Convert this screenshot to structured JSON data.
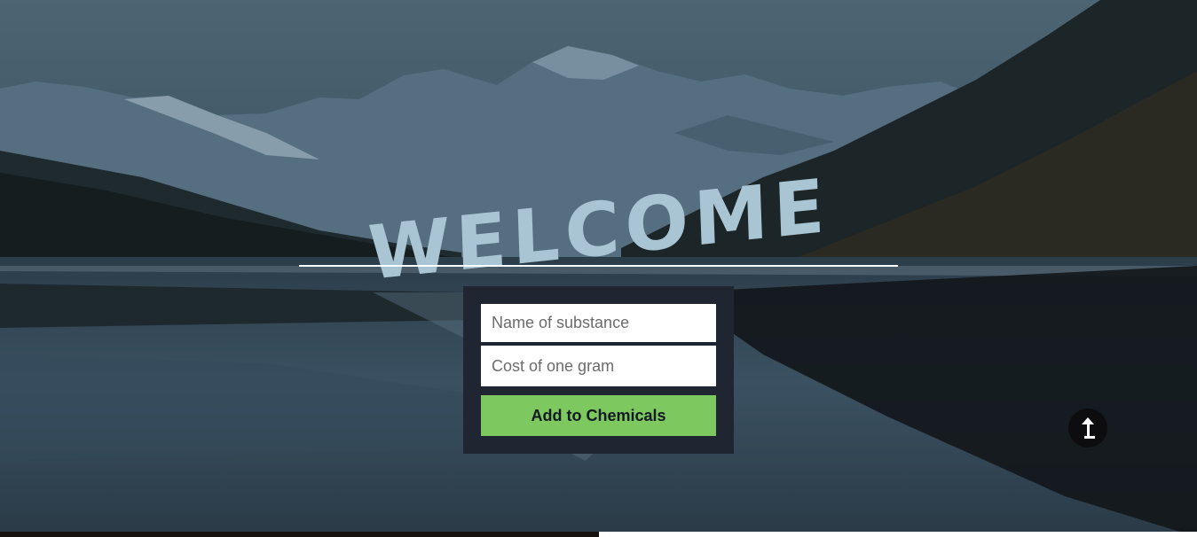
{
  "hero": {
    "title": "WELCOME"
  },
  "form": {
    "name_placeholder": "Name of substance",
    "cost_placeholder": "Cost of one gram",
    "submit_label": "Add to Chemicals"
  },
  "scroll_top": {
    "icon": "arrow-up-icon"
  },
  "colors": {
    "title": "#a9c5d3",
    "panel": "#1f2631",
    "button": "#7ec95f",
    "button_text": "#111a22"
  }
}
